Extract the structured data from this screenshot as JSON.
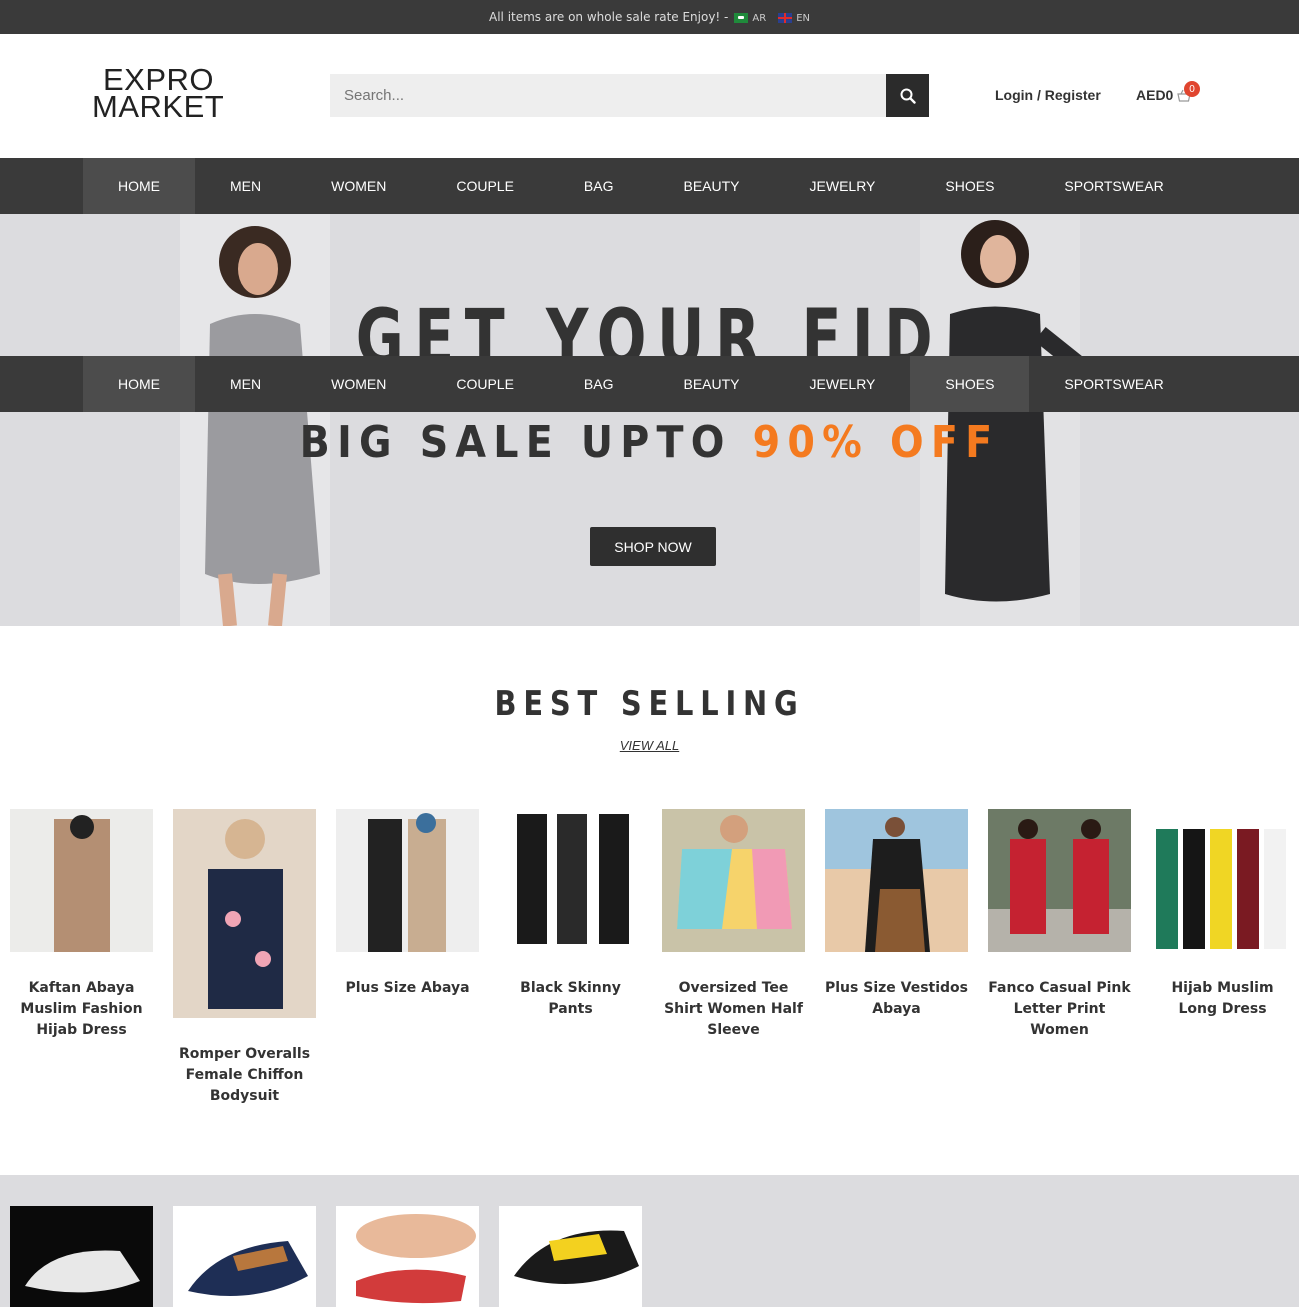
{
  "topbar": {
    "text": "All items are on whole sale rate Enjoy! -",
    "lang_ar": "AR",
    "lang_en": "EN"
  },
  "logo": {
    "line1": "EXPRO",
    "line2": "MARKET"
  },
  "search": {
    "placeholder": "Search..."
  },
  "header": {
    "login": "Login / Register",
    "cart_label": "AED0",
    "cart_count": "0"
  },
  "nav": {
    "items": [
      "HOME",
      "MEN",
      "WOMEN",
      "COUPLE",
      "BAG",
      "BEAUTY",
      "JEWELRY",
      "SHOES",
      "SPORTSWEAR"
    ]
  },
  "hero": {
    "title": "GET YOUR FID",
    "sale_prefix": "BIG SALE UPTO",
    "sale_highlight": "90% OFF",
    "cta": "SHOP NOW"
  },
  "best_selling": {
    "title": "BEST SELLING",
    "view_all": "VIEW ALL",
    "products": [
      {
        "name": "Kaftan Abaya Muslim Fashion Hijab Dress"
      },
      {
        "name": "Romper Overalls Female Chiffon Bodysuit"
      },
      {
        "name": "Plus Size Abaya"
      },
      {
        "name": "Black Skinny Pants"
      },
      {
        "name": "Oversized Tee Shirt Women Half Sleeve"
      },
      {
        "name": "Plus Size Vestidos Abaya"
      },
      {
        "name": "Fanco Casual Pink Letter Print Women"
      },
      {
        "name": "Hijab Muslim Long Dress"
      }
    ]
  },
  "colors": {
    "dark": "#3a3a3a",
    "accent": "#f47a1f",
    "hero_bg": "#dcdcdf",
    "badge": "#e0452f"
  }
}
